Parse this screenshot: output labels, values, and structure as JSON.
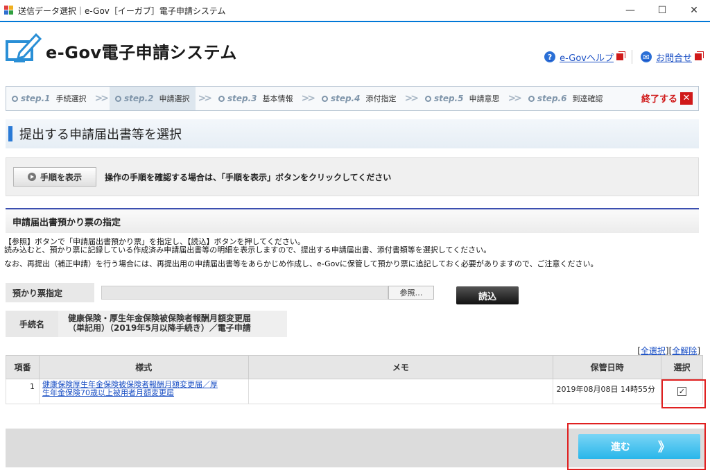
{
  "window": {
    "title": "送信データ選択｜e-Gov［イーガブ］電子申請システム",
    "minimize": "—",
    "maximize": "☐",
    "close": "✕"
  },
  "header": {
    "logo_text": "e-Gov電子申請システム",
    "help_link": "e-Govヘルプ",
    "contact_link": "お問合せ"
  },
  "steps": [
    {
      "num": "step.1",
      "label": "手続選択"
    },
    {
      "num": "step.2",
      "label": "申請選択"
    },
    {
      "num": "step.3",
      "label": "基本情報"
    },
    {
      "num": "step.4",
      "label": "添付指定"
    },
    {
      "num": "step.5",
      "label": "申請意思"
    },
    {
      "num": "step.6",
      "label": "到達確認"
    }
  ],
  "quit_label": "終了する",
  "page_title": "提出する申請届出書等を選択",
  "guide": {
    "button": "手順を表示",
    "message": "操作の手順を確認する場合は、「手順を表示」ボタンをクリックしてください"
  },
  "section_title": "申請届出書預かり票の指定",
  "description": [
    "【参照】ボタンで「申請届出書預かり票」を指定し、【読込】ボタンを押してください。",
    "読み込むと、預かり票に記録している作成済み申請届出書等の明細を表示しますので、提出する申請届出書、添付書類等を選択してください。",
    "なお、再提出（補正申請）を行う場合には、再提出用の申請届出書等をあらかじめ作成し、e-Govに保管して預かり票に追記しておく必要がありますので、ご注意ください。"
  ],
  "form": {
    "ticket_label": "預かり票指定",
    "browse": "参照…",
    "read": "読込",
    "proc_label": "手続名",
    "proc_name_1": "健康保険・厚生年金保険被保険者報酬月額変更届",
    "proc_name_2": "（単記用）（2019年5月以降手続き）／電子申請"
  },
  "select_all": "全選択",
  "deselect_all": "全解除",
  "table": {
    "headers": [
      "項番",
      "様式",
      "メモ",
      "保管日時",
      "選択"
    ],
    "rows": [
      {
        "num": "1",
        "form_1": "健康保険厚生年金保険被保険者報酬月額変更届／厚",
        "form_2": "生年金保険70歳以上被用者月額変更届",
        "memo": "",
        "date": "2019年08月08日 14時55分",
        "checked": "✓"
      }
    ]
  },
  "next_button": "進む",
  "next_arrows": "》"
}
